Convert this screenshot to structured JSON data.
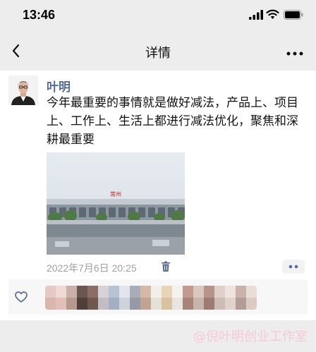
{
  "status_bar": {
    "time": "13:46",
    "icons": [
      "signal-icon",
      "wifi-icon",
      "battery-icon"
    ]
  },
  "nav": {
    "title": "详情",
    "back_icon": "chevron-left-icon",
    "more_icon": "more-dots-icon"
  },
  "post": {
    "author": "叶明",
    "text": "今年最重要的事情就是做好减法，产品上、项目上、工作上、生活上都进行减法优化，聚焦和深耕最重要",
    "image_sign_text": "常州",
    "time": "2022年7月6日 20:25",
    "delete_icon": "trash-icon",
    "action_icon": "two-dots-icon"
  },
  "likes": {
    "icon": "heart-icon",
    "liker_colors": [
      [
        "#e7c9c4",
        "#d9b6ad"
      ],
      [
        "#f0d8d4",
        "#e2bfb8"
      ],
      [
        "#c9b0a9",
        "#b59890"
      ],
      [
        "#6a5650",
        "#4f3e3a"
      ],
      [
        "#8b6f66",
        "#705851"
      ],
      [
        "#d7d2d5",
        "#c2bec3"
      ],
      [
        "#b8c3d2",
        "#a4b0c1"
      ],
      [
        "#e2e6ec",
        "#cfd4dc"
      ],
      [
        "#a8adb8",
        "#959aa6"
      ],
      [
        "#d3b9a6",
        "#c0a390"
      ],
      [
        "#f2efe9",
        "#e5e1d9"
      ],
      [
        "#e8d4b8",
        "#d9c29f"
      ],
      [
        "#f4f1ee",
        "#e9e4e0"
      ],
      [
        "#c29a8e",
        "#a9827a"
      ],
      [
        "#d8c8c0",
        "#c7b5ad"
      ],
      [
        "#b7948a",
        "#9e7b71"
      ],
      [
        "#e0cfca",
        "#cfbbb5"
      ],
      [
        "#efe3de",
        "#e2d2cc"
      ],
      [
        "#c8b2ab",
        "#b39c95"
      ],
      [
        "#eadcd6",
        "#dccbc3"
      ]
    ]
  },
  "watermark": "@倪叶明创业工作室"
}
